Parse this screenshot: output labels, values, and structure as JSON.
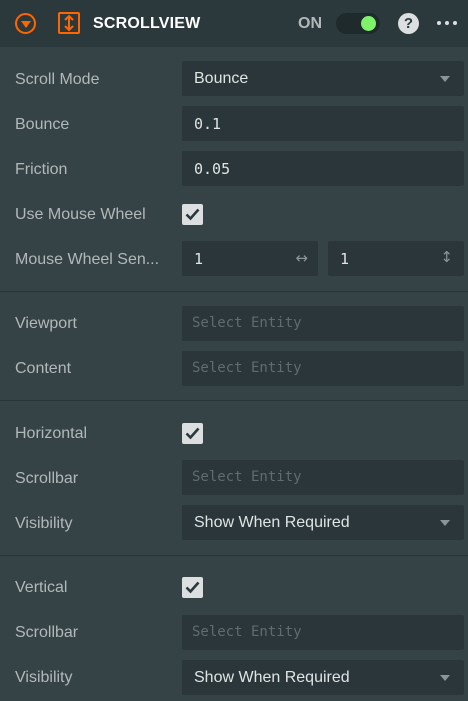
{
  "header": {
    "title": "SCROLLVIEW",
    "enabled_label": "ON",
    "help": "?",
    "accent": "#ff6600",
    "toggle_on_color": "#7ff26a"
  },
  "scroll": {
    "mode_label": "Scroll Mode",
    "mode_value": "Bounce",
    "bounce_label": "Bounce",
    "bounce_value": "0.1",
    "friction_label": "Friction",
    "friction_value": "0.05",
    "use_mouse_wheel_label": "Use Mouse Wheel",
    "use_mouse_wheel_checked": true,
    "wheel_sensitivity_label": "Mouse Wheel Sen...",
    "wheel_sensitivity_x": "1",
    "wheel_sensitivity_y": "1",
    "x_arrow": "↔",
    "y_arrow": "↕"
  },
  "entities": {
    "viewport_label": "Viewport",
    "viewport_placeholder": "Select Entity",
    "content_label": "Content",
    "content_placeholder": "Select Entity"
  },
  "horizontal": {
    "label": "Horizontal",
    "checked": true,
    "scrollbar_label": "Scrollbar",
    "scrollbar_placeholder": "Select Entity",
    "visibility_label": "Visibility",
    "visibility_value": "Show When Required"
  },
  "vertical": {
    "label": "Vertical",
    "checked": true,
    "scrollbar_label": "Scrollbar",
    "scrollbar_placeholder": "Select Entity",
    "visibility_label": "Visibility",
    "visibility_value": "Show When Required"
  }
}
